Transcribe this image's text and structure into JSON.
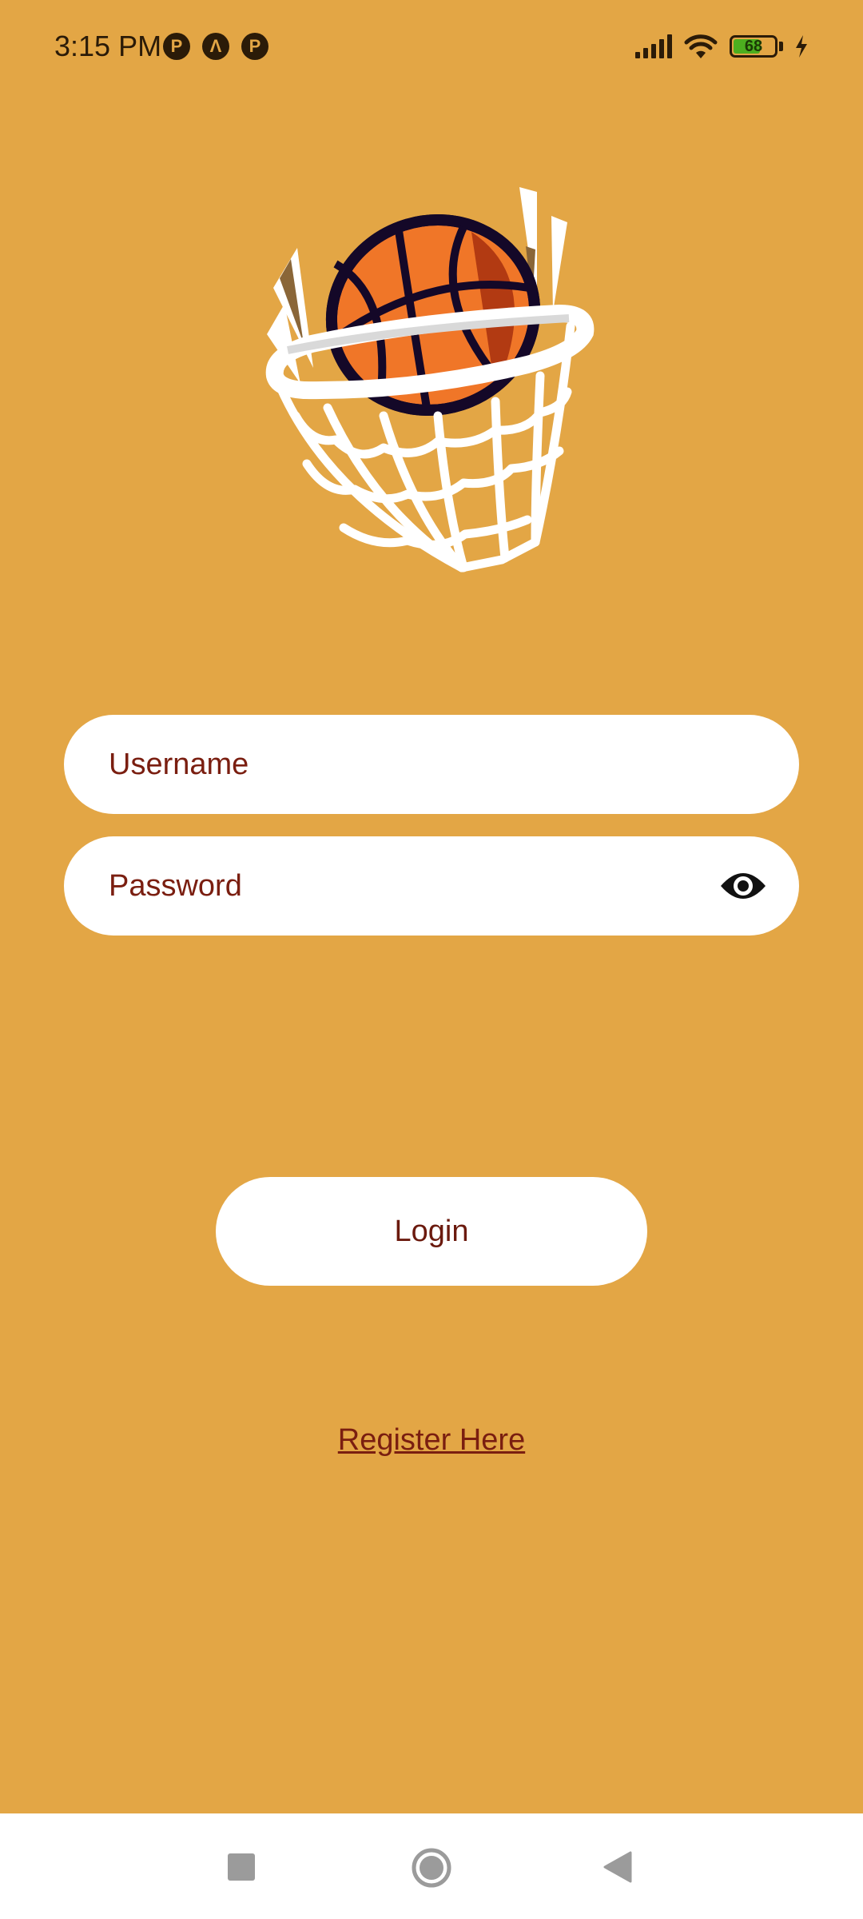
{
  "status_bar": {
    "time": "3:15 PM",
    "notification_icons": [
      "P",
      "Λ",
      "P"
    ],
    "battery_level": "68",
    "icons": [
      "signal-icon",
      "wifi-icon",
      "battery-icon",
      "charging-icon"
    ]
  },
  "logo": {
    "icon": "basketball-hoop-icon"
  },
  "form": {
    "username_placeholder": "Username",
    "password_placeholder": "Password",
    "password_toggle_icon": "eye-icon"
  },
  "actions": {
    "login_label": "Login",
    "register_label": "Register Here"
  },
  "nav_bar": {
    "icons": [
      "recents-icon",
      "home-icon",
      "back-icon"
    ]
  },
  "colors": {
    "background": "#E3A645",
    "text_accent": "#7A1E10",
    "field_background": "#FFFFFF",
    "ball": "#F07628"
  }
}
